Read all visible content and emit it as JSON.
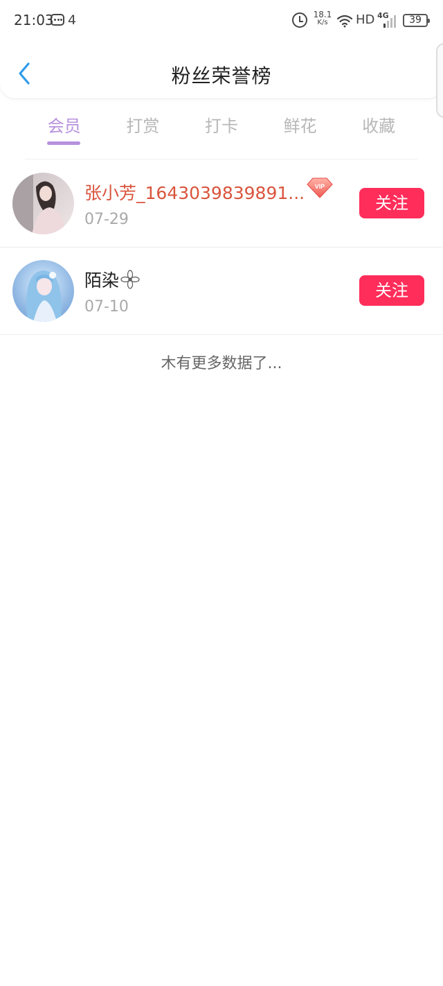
{
  "status_bar": {
    "time": "21:03",
    "notification_count": "4",
    "net_speed_value": "18.1",
    "net_speed_unit": "K/s",
    "hd_label": "HD",
    "network_type": "4G",
    "battery_level": "39"
  },
  "nav": {
    "title": "粉丝荣誉榜",
    "back_icon": "chevron-left-icon"
  },
  "tabs": [
    {
      "label": "会员",
      "active": true
    },
    {
      "label": "打赏",
      "active": false
    },
    {
      "label": "打卡",
      "active": false
    },
    {
      "label": "鲜花",
      "active": false
    },
    {
      "label": "收藏",
      "active": false
    }
  ],
  "fans": [
    {
      "name": "张小芳_1643039839891...",
      "date": "07-29",
      "vip": true,
      "follow_label": "关注"
    },
    {
      "name": "陌染",
      "date": "07-10",
      "vip": false,
      "follow_label": "关注"
    }
  ],
  "footer": {
    "no_more_text": "木有更多数据了..."
  },
  "colors": {
    "accent_purple": "#b791de",
    "follow_red": "#ff2d5a",
    "vip_name": "#d9543c",
    "back_blue": "#2f9bea"
  }
}
